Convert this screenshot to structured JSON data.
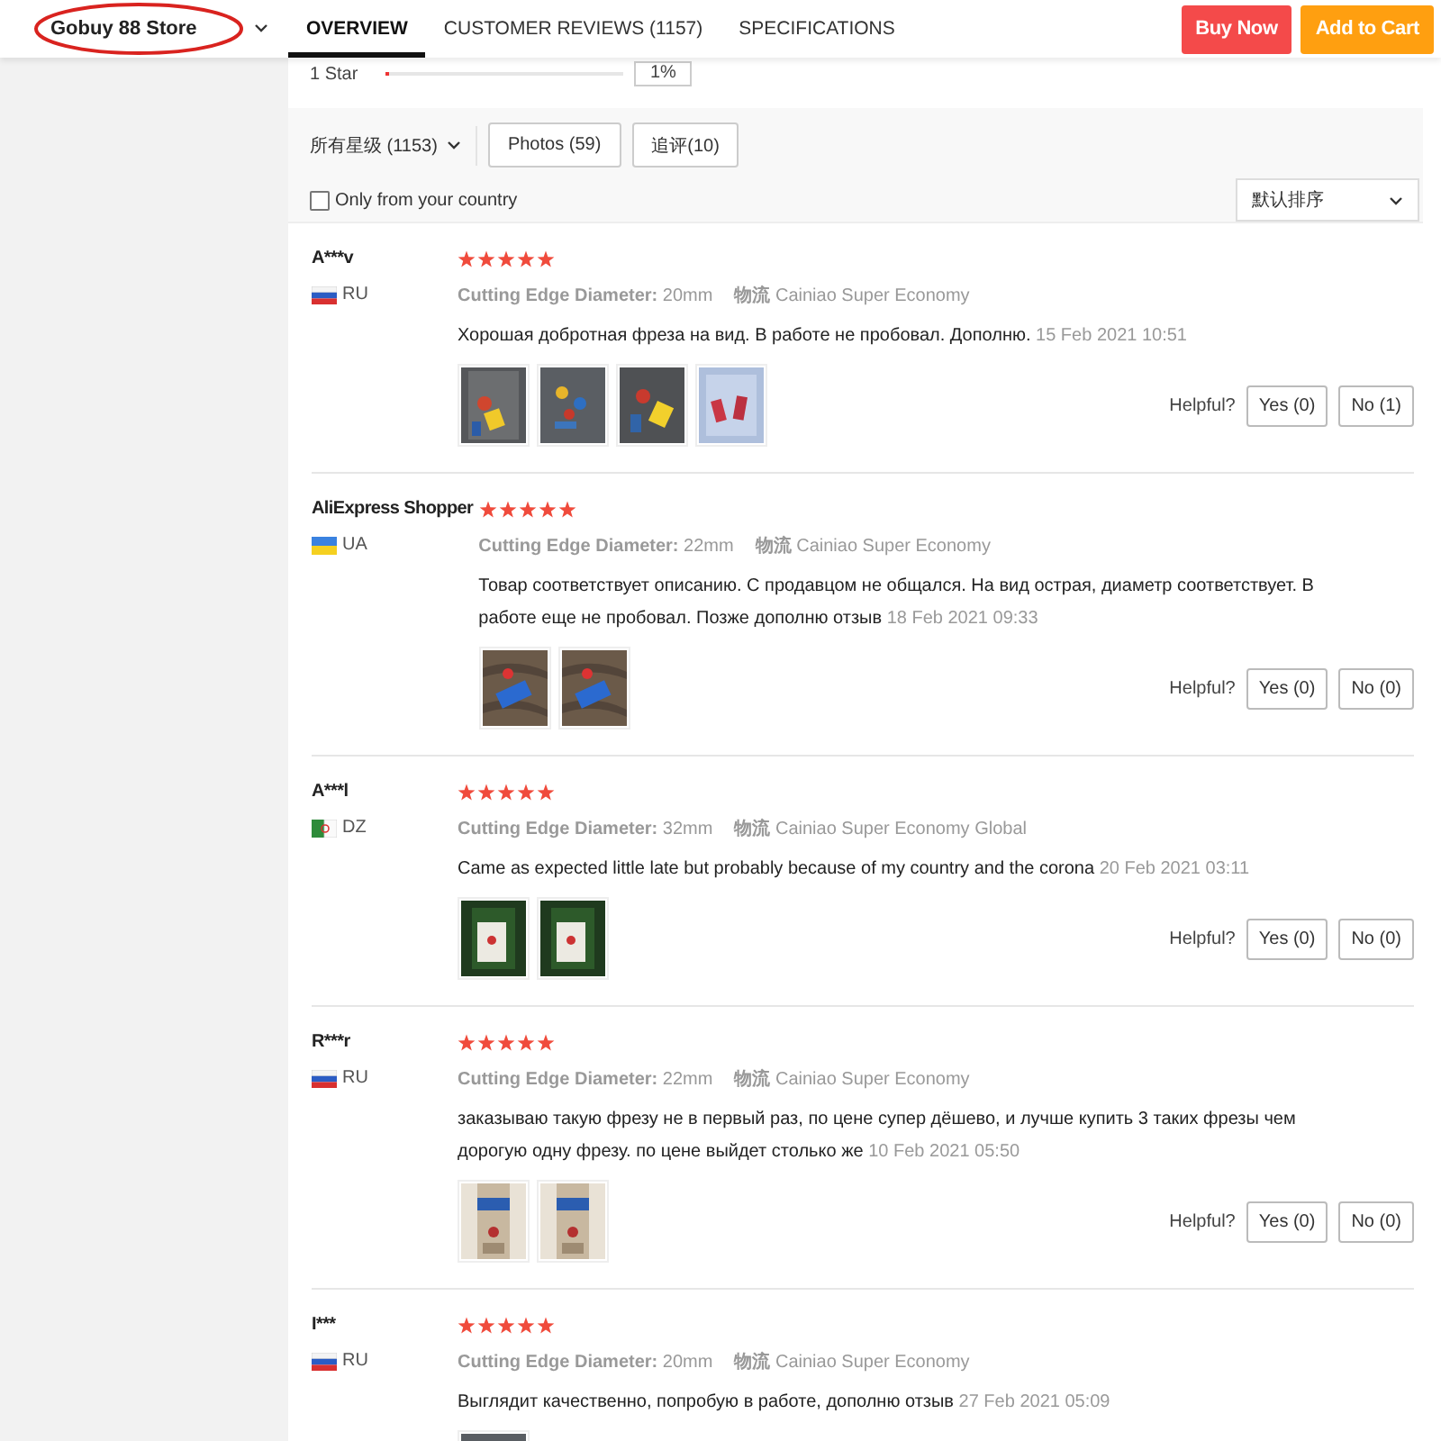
{
  "header": {
    "store_name": "Gobuy 88 Store",
    "annotated": true,
    "tabs": [
      {
        "label": "OVERVIEW",
        "selected": true
      },
      {
        "label": "CUSTOMER REVIEWS (1157)",
        "selected": false
      },
      {
        "label": "SPECIFICATIONS",
        "selected": false
      }
    ],
    "buttons": [
      {
        "label": "Buy Now",
        "kind": "buy"
      },
      {
        "label": "Add to Cart",
        "kind": "cart"
      }
    ]
  },
  "rating_row": {
    "label": "1 Star",
    "level": 0.01,
    "percent": "1%"
  },
  "filters": {
    "star_filter": "所有星级 (1153)",
    "buttons": [
      "Photos (59)",
      "追评(10)"
    ],
    "only_country": {
      "label": "Only from your country",
      "checked": false
    },
    "sort": "默认排序"
  },
  "reviews": [
    {
      "name": "A***v",
      "flag": {
        "kind": "ru"
      },
      "country": "RU",
      "stars": 5,
      "attributes": [
        "**Cutting Edge Diameter:** 20mm",
        "**物流** Cainiao Super Economy"
      ],
      "text": "Хорошая добротная фреза на вид. В работе не пробовал. Дополню.",
      "date": "15 Feb 2021 10:51",
      "photos": [
        {
          "kind": "picture"
        },
        {
          "kind": "picture"
        },
        {
          "kind": "picture"
        },
        {
          "kind": "picture"
        }
      ],
      "helpful": {
        "label": "Helpful?",
        "yes": "Yes (0)",
        "no": "No (1)"
      }
    },
    {
      "name": "AliExpress Shopper",
      "flag": {
        "kind": "ua"
      },
      "country": "UA",
      "stars": 5,
      "attributes": [
        "**Cutting Edge Diameter:** 22mm",
        "**物流** Cainiao Super Economy"
      ],
      "text": "Товар соответствует описанию. С продавцом не общался. На вид острая, диаметр соответствует. В работе еще не пробовал. Позже дополню отзыв",
      "date": "18 Feb 2021 09:33",
      "photos": [
        {
          "kind": "picture"
        },
        {
          "kind": "picture"
        }
      ],
      "helpful": {
        "label": "Helpful?",
        "yes": "Yes (0)",
        "no": "No (0)"
      }
    },
    {
      "name": "A***l",
      "flag": {
        "kind": "dz"
      },
      "country": "DZ",
      "stars": 5,
      "attributes": [
        "**Cutting Edge Diameter:** 32mm",
        "**物流** Cainiao Super Economy Global"
      ],
      "text": "Came as expected little late but probably because of my country and the corona",
      "date": "20 Feb 2021 03:11",
      "photos": [
        {
          "kind": "picture"
        },
        {
          "kind": "picture"
        }
      ],
      "helpful": {
        "label": "Helpful?",
        "yes": "Yes (0)",
        "no": "No (0)"
      }
    },
    {
      "name": "R***r",
      "flag": {
        "kind": "ru"
      },
      "country": "RU",
      "stars": 5,
      "attributes": [
        "**Cutting Edge Diameter:** 22mm",
        "**物流** Cainiao Super Economy"
      ],
      "text": "заказываю такую фрезу не в первый раз, по цене супер дёшево, и лучше купить 3 таких фрезы чем дорогую одну фрезу. по цене выйдет столько же",
      "date": "10 Feb 2021 05:50",
      "photos": [
        {
          "kind": "picture"
        },
        {
          "kind": "picture"
        }
      ],
      "helpful": {
        "label": "Helpful?",
        "yes": "Yes (0)",
        "no": "No (0)"
      }
    },
    {
      "name": "I***",
      "flag": {
        "kind": "ru"
      },
      "country": "RU",
      "stars": 5,
      "attributes": [
        "**Cutting Edge Diameter:** 20mm",
        "**物流** Cainiao Super Economy"
      ],
      "text": "Выглядит качественно, попробую в работе, дополню отзыв",
      "date": "27 Feb 2021 05:09",
      "photos": [
        {
          "kind": "picture"
        }
      ]
    }
  ]
}
